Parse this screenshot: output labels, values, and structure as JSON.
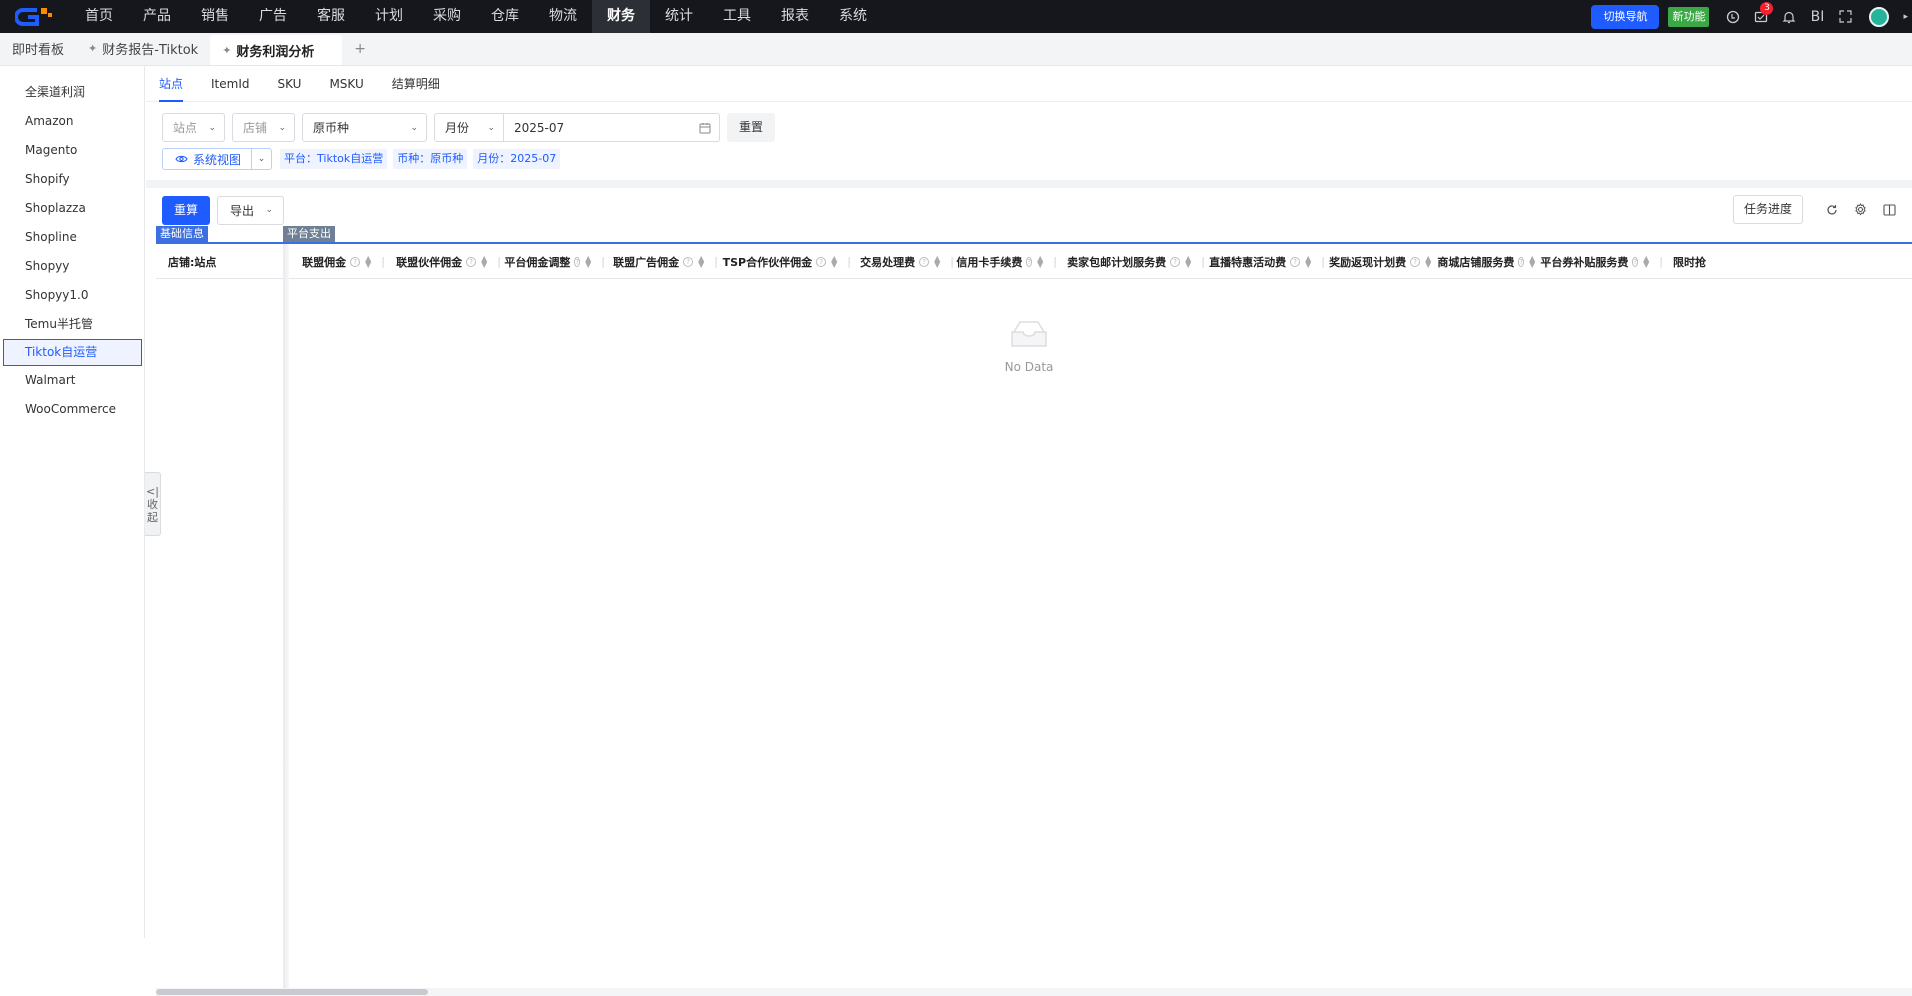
{
  "top_nav": {
    "items": [
      "首页",
      "产品",
      "销售",
      "广告",
      "客服",
      "计划",
      "采购",
      "仓库",
      "物流",
      "财务",
      "统计",
      "工具",
      "报表",
      "系统"
    ],
    "active_index": 9,
    "switch_nav_label": "切换导航",
    "new_feature_label": "新功能",
    "notification_count": "3",
    "bi_label": "BI",
    "icons": [
      "history-icon",
      "task-icon",
      "bell-icon",
      "bi-icon",
      "fullscreen-icon",
      "avatar"
    ]
  },
  "page_tabs": {
    "items": [
      "即时看板",
      "财务报告-Tiktok",
      "财务利润分析"
    ],
    "active_index": 2,
    "add_label": "+"
  },
  "sidebar": {
    "items": [
      "全渠道利润",
      "Amazon",
      "Magento",
      "Shopify",
      "Shoplazza",
      "Shopline",
      "Shopyy",
      "Shopyy1.0",
      "Temu半托管",
      "Tiktok自运营",
      "Walmart",
      "WooCommerce"
    ],
    "active_index": 9,
    "collapse_label": [
      "<|",
      "收",
      "起"
    ]
  },
  "sub_tabs": {
    "items": [
      "站点",
      "ItemId",
      "SKU",
      "MSKU",
      "结算明细"
    ],
    "active_index": 0
  },
  "filters": {
    "site_placeholder": "站点",
    "store_placeholder": "店铺",
    "currency_value": "原币种",
    "period_type": "月份",
    "date_value": "2025-07",
    "reset_label": "重置"
  },
  "view_row": {
    "view_label": "系统视图",
    "chips": [
      "平台：Tiktok自运营",
      "币种：原币种",
      "月份：2025-07"
    ]
  },
  "toolbar": {
    "recalc_label": "重算",
    "export_label": "导出",
    "task_progress_label": "任务进度",
    "icons": [
      "refresh-icon",
      "settings-icon",
      "columns-icon"
    ]
  },
  "table": {
    "group_headers": [
      "基础信息",
      "平台支出"
    ],
    "first_column": "店铺:站点",
    "columns": [
      "联盟佣金",
      "联盟伙伴佣金",
      "平台佣金调整",
      "联盟广告佣金",
      "TSP合作伙伴佣金",
      "交易处理费",
      "信用卡手续费",
      "卖家包邮计划服务费",
      "直播特惠活动费",
      "奖励返现计划费",
      "商城店铺服务费",
      "平台券补贴服务费",
      "限时抢"
    ],
    "empty_text": "No Data"
  },
  "colors": {
    "primary": "#1f5cff",
    "topbar": "#15171c",
    "new_feature": "#39a845",
    "badge": "#f5222d",
    "active_border": "#e02424"
  }
}
